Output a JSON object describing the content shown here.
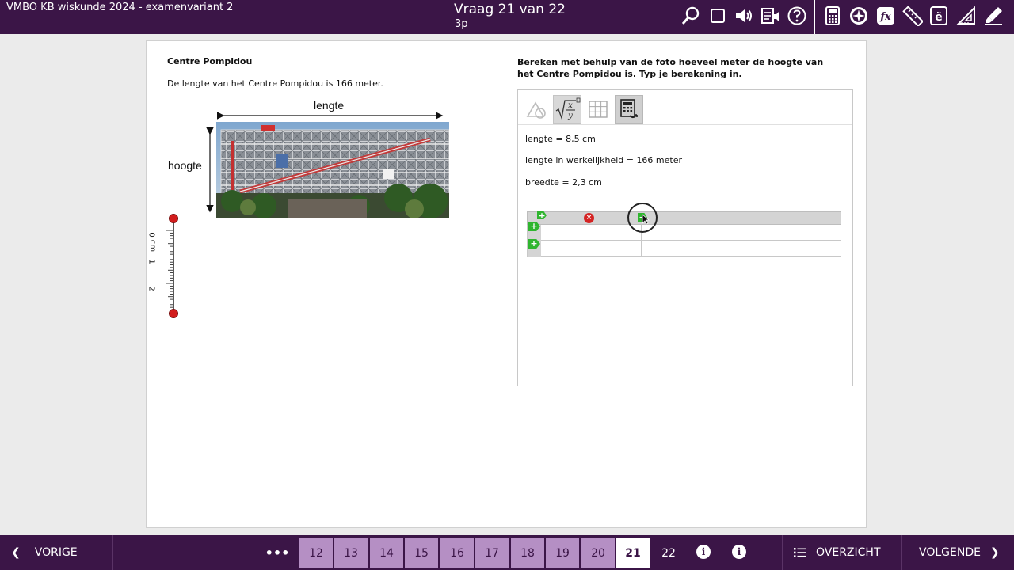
{
  "header": {
    "exam_title": "VMBO KB wiskunde 2024 - examenvariant 2",
    "question_title": "Vraag 21 van 22",
    "points": "3p",
    "tools": [
      {
        "name": "zoom",
        "icon": "magnifier-icon"
      },
      {
        "name": "mask",
        "icon": "square-icon"
      },
      {
        "name": "audio",
        "icon": "speaker-icon"
      },
      {
        "name": "read-aloud",
        "icon": "read-aloud-icon"
      },
      {
        "name": "help",
        "icon": "question-icon"
      },
      {
        "name": "calculator",
        "icon": "calculator-icon"
      },
      {
        "name": "compass",
        "icon": "compass-icon"
      },
      {
        "name": "formula-sheet",
        "icon": "fx-icon"
      },
      {
        "name": "ruler",
        "icon": "ruler-icon"
      },
      {
        "name": "special-characters",
        "icon": "e-umlaut-icon"
      },
      {
        "name": "protractor",
        "icon": "set-square-icon"
      },
      {
        "name": "marker",
        "icon": "highlighter-icon"
      }
    ]
  },
  "left": {
    "title": "Centre Pompidou",
    "text": "De lengte van het Centre Pompidou is 166 meter.",
    "photo_label_length": "lengte",
    "photo_label_height": "hoogte",
    "ruler": {
      "unit": "cm",
      "labels": [
        "0",
        "1",
        "2"
      ]
    }
  },
  "right": {
    "question": "Bereken met behulp van de foto hoeveel meter de hoogte van het Centre Pompidou is. Typ je berekening in.",
    "toolbar": [
      {
        "name": "geometry",
        "icon": "triangle-circle-icon",
        "state": "inactive"
      },
      {
        "name": "formula",
        "icon": "sqrt-fraction-icon",
        "state": "active"
      },
      {
        "name": "table",
        "icon": "grid-icon",
        "state": "inactive"
      },
      {
        "name": "calculator",
        "icon": "calculator-icon",
        "state": "selected"
      }
    ],
    "answer_lines": [
      "lengte = 8,5 cm",
      "lengte in werkelijkheid = 166 meter",
      "breedte = 2,3 cm"
    ],
    "table": {
      "rows": [
        [
          "",
          "",
          ""
        ],
        [
          "",
          "",
          ""
        ]
      ],
      "add_symbol": "+",
      "delete_symbol": "×"
    }
  },
  "footer": {
    "prev_label": "VORIGE",
    "next_label": "VOLGENDE",
    "overview_label": "OVERZICHT",
    "more_label": "•••",
    "info_symbol": "i",
    "questions": [
      {
        "label": "12",
        "state": "answered"
      },
      {
        "label": "13",
        "state": "answered"
      },
      {
        "label": "14",
        "state": "answered"
      },
      {
        "label": "15",
        "state": "answered"
      },
      {
        "label": "16",
        "state": "answered"
      },
      {
        "label": "17",
        "state": "answered"
      },
      {
        "label": "18",
        "state": "answered"
      },
      {
        "label": "19",
        "state": "answered"
      },
      {
        "label": "20",
        "state": "answered"
      },
      {
        "label": "21",
        "state": "current"
      },
      {
        "label": "22",
        "state": "unanswered"
      }
    ]
  },
  "colors": {
    "bar": "#3b1547",
    "answered": "#b58fc4",
    "add_green": "#2fb52f",
    "delete_red": "#d42323"
  }
}
